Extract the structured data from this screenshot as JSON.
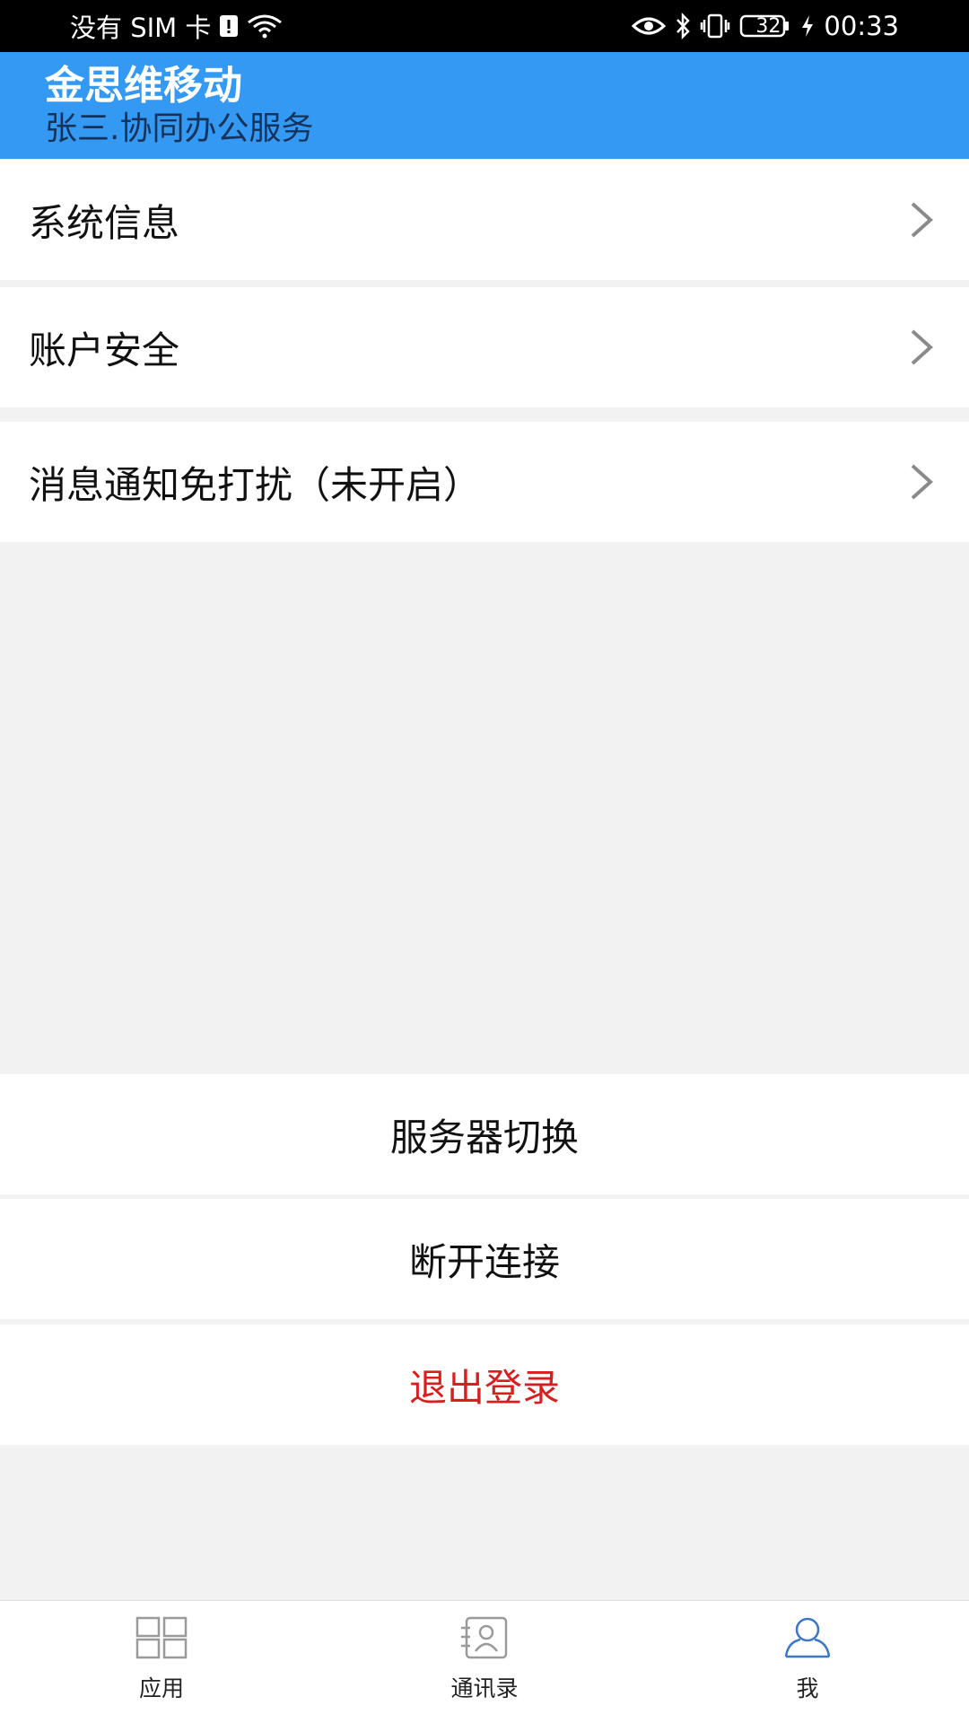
{
  "status_bar": {
    "carrier": "没有 SIM 卡",
    "battery": "32",
    "time": "00:33"
  },
  "header": {
    "title": "金思维移动",
    "subtitle": "张三.协同办公服务"
  },
  "menu": {
    "items": [
      {
        "label": "系统信息"
      },
      {
        "label": "账户安全"
      },
      {
        "label": "消息通知免打扰（未开启）"
      }
    ]
  },
  "actions": {
    "server_switch": "服务器切换",
    "disconnect": "断开连接",
    "logout": "退出登录"
  },
  "bottom_nav": {
    "items": [
      {
        "label": "应用",
        "icon": "grid-icon"
      },
      {
        "label": "通讯录",
        "icon": "contacts-icon"
      },
      {
        "label": "我",
        "icon": "user-icon"
      }
    ]
  },
  "colors": {
    "header": "#3399f3",
    "logout": "#d81e1e",
    "active_nav": "#3b76c9"
  }
}
